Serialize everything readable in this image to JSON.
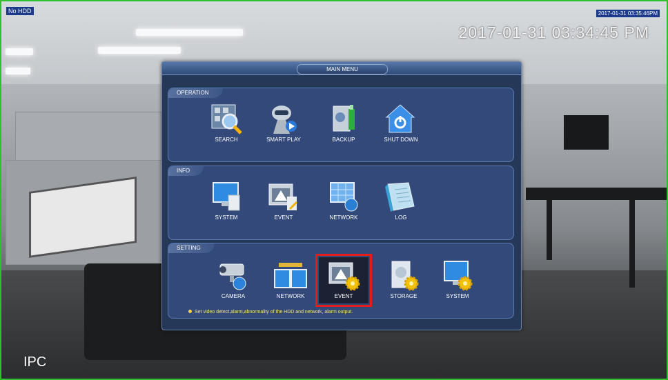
{
  "osd": {
    "hdd_badge": "No HDD",
    "small_timestamp": "2017-01-31 03:35:46PM",
    "timestamp": "2017-01-31 03:34:45 PM",
    "channel_name": "IPC"
  },
  "menu": {
    "title": "MAIN MENU",
    "sections": [
      {
        "label": "OPERATION",
        "items": [
          {
            "label": "SEARCH",
            "icon": "search-icon"
          },
          {
            "label": "SMART PLAY",
            "icon": "smart-play-icon"
          },
          {
            "label": "BACKUP",
            "icon": "backup-icon"
          },
          {
            "label": "SHUT DOWN",
            "icon": "shutdown-icon"
          }
        ]
      },
      {
        "label": "INFO",
        "items": [
          {
            "label": "SYSTEM",
            "icon": "system-info-icon"
          },
          {
            "label": "EVENT",
            "icon": "event-info-icon"
          },
          {
            "label": "NETWORK",
            "icon": "network-info-icon"
          },
          {
            "label": "LOG",
            "icon": "log-icon"
          }
        ]
      },
      {
        "label": "SETTING",
        "items": [
          {
            "label": "CAMERA",
            "icon": "camera-icon"
          },
          {
            "label": "NETWORK",
            "icon": "network-setting-icon"
          },
          {
            "label": "EVENT",
            "icon": "event-setting-icon",
            "selected": true
          },
          {
            "label": "STORAGE",
            "icon": "storage-icon"
          },
          {
            "label": "SYSTEM",
            "icon": "system-setting-icon"
          }
        ]
      }
    ],
    "hint": "Set video detect,alarm,abnormality of the HDD and network, alarm output."
  },
  "colors": {
    "selection": "#e51c1c",
    "menu_bg": "#253858",
    "section_bg": "#33497a",
    "hint": "#f5e86a"
  }
}
